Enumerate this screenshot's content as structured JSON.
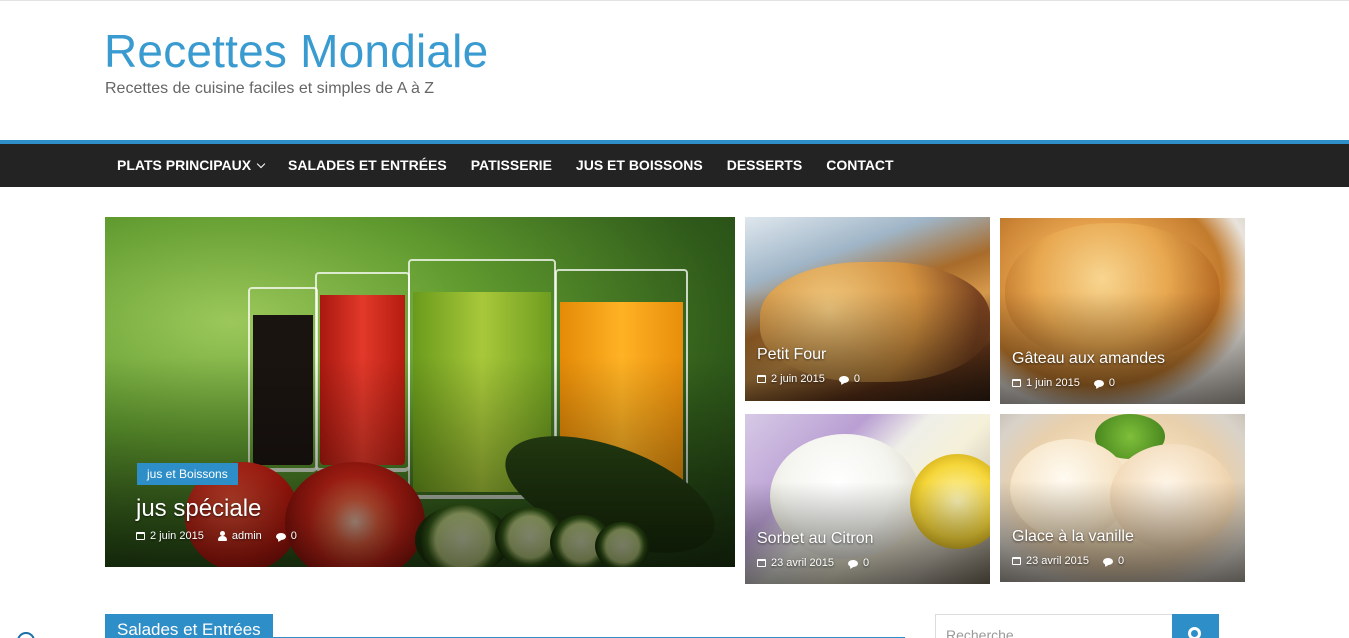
{
  "site": {
    "title": "Recettes Mondiale",
    "description": "Recettes de cuisine faciles et simples de A à Z"
  },
  "nav": {
    "items": [
      {
        "label": "PLATS PRINCIPAUX",
        "has_dropdown": true
      },
      {
        "label": "SALADES ET ENTRÉES"
      },
      {
        "label": "PATISSERIE"
      },
      {
        "label": "JUS ET BOISSONS"
      },
      {
        "label": "DESSERTS"
      },
      {
        "label": "CONTACT"
      }
    ]
  },
  "featured": {
    "main": {
      "category": "jus et Boissons",
      "title": "jus spéciale",
      "date": "2 juin 2015",
      "author": "admin",
      "comments": "0"
    },
    "tiles": [
      {
        "title": "Petit Four",
        "date": "2 juin 2015",
        "comments": "0"
      },
      {
        "title": "Gâteau aux amandes",
        "date": "1 juin 2015",
        "comments": "0"
      },
      {
        "title": "Sorbet au Citron",
        "date": "23 avril 2015",
        "comments": "0"
      },
      {
        "title": "Glace à la vanille",
        "date": "23 avril 2015",
        "comments": "0"
      }
    ]
  },
  "section": {
    "title": "Salades et Entrées"
  },
  "search": {
    "placeholder": "Recherche"
  },
  "colors": {
    "accent": "#2e8fc8",
    "nav_bg": "#232323",
    "title": "#3a9bd0"
  }
}
